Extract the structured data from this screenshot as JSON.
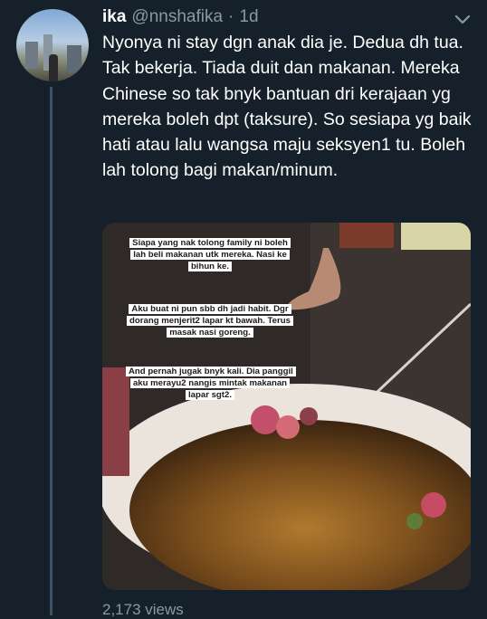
{
  "tweet": {
    "author_name": "ika",
    "author_handle": "@nnshafika",
    "separator": "·",
    "timestamp": "1d",
    "text": "Nyonya ni stay dgn anak dia je. Dedua dh tua. Tak bekerja. Tiada duit dan makanan. Mereka Chinese so tak bnyk bantuan dri kerajaan yg mereka boleh dpt (taksure). So sesiapa yg baik hati atau lalu wangsa maju seksyen1 tu. Boleh lah tolong bagi makan/minum.",
    "views": "2,173 views"
  },
  "media": {
    "captions": [
      "Siapa yang nak tolong family ni boleh lah beli makanan utk mereka. Nasi ke bihun ke.",
      "Aku buat ni pun sbb dh jadi habit. Dgr dorang menjerit2 lapar kt bawah. Terus masak nasi goreng.",
      "And pernah jugak bnyk kali. Dia panggil aku merayu2 nangis mintak makanan lapar sgt2."
    ]
  },
  "icons": {
    "caret": "chevron-down-icon"
  },
  "colors": {
    "background": "#15202b",
    "secondary_text": "#8899a6",
    "primary_text": "#ffffff"
  }
}
